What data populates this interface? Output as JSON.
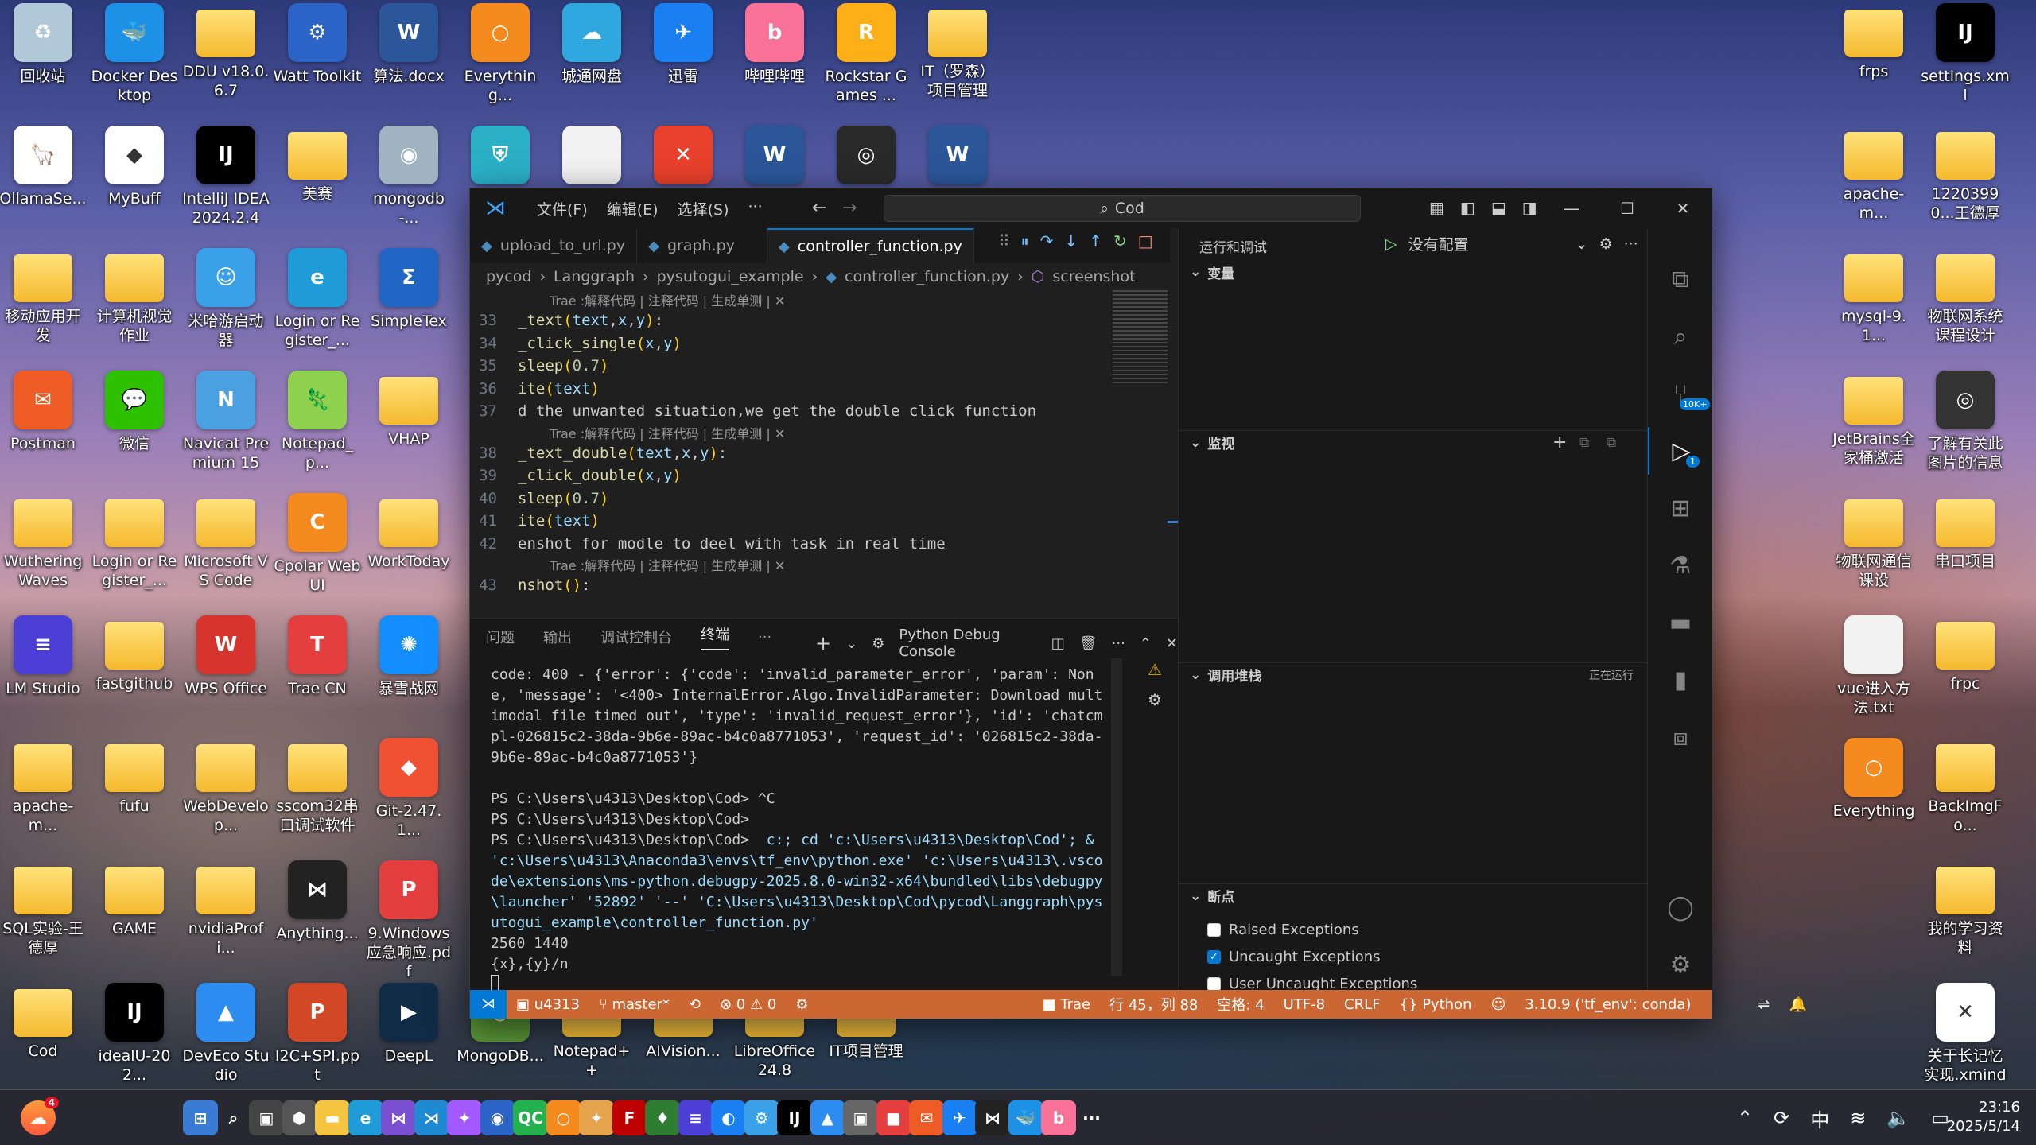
{
  "desktop_icons": [
    {
      "id": "recycle",
      "label": "回收站",
      "glyph": "♻",
      "color": "#b0c8d8"
    },
    {
      "id": "docker",
      "label": "Docker Desktop",
      "glyph": "🐳",
      "color": "#1d91e6"
    },
    {
      "id": "ddu",
      "label": "DDU v18.0.6.7",
      "glyph": "",
      "color": "folder"
    },
    {
      "id": "watt",
      "label": "Watt Toolkit",
      "glyph": "⚙",
      "color": "#2b63c6"
    },
    {
      "id": "docx1",
      "label": "算法.docx",
      "glyph": "W",
      "color": "#2b579a"
    },
    {
      "id": "everything1",
      "label": "Everything...",
      "glyph": "○",
      "color": "#f58a1f"
    },
    {
      "id": "cloud",
      "label": "城通网盘",
      "glyph": "☁",
      "color": "#2fa8e0"
    },
    {
      "id": "xunlei",
      "label": "迅雷",
      "glyph": "✈",
      "color": "#1a7ff0"
    },
    {
      "id": "bilibili",
      "label": "哔哩哔哩",
      "glyph": "b",
      "color": "#fb7299"
    },
    {
      "id": "rockstar",
      "label": "Rockstar Games ...",
      "glyph": "R",
      "color": "#fcaf17"
    },
    {
      "id": "itproj",
      "label": "IT（罗森）项目管理",
      "glyph": "",
      "color": "folder"
    },
    {
      "id": "ollama",
      "label": "OllamaSe...",
      "glyph": "🦙",
      "color": "#ffffff"
    },
    {
      "id": "mybuff",
      "label": "MyBuff",
      "glyph": "◆",
      "color": "#ffffff"
    },
    {
      "id": "idea",
      "label": "IntelliJ IDEA 2024.2.4",
      "glyph": "IJ",
      "color": "#000000"
    },
    {
      "id": "meisai",
      "label": "美赛",
      "glyph": "",
      "color": "folder"
    },
    {
      "id": "mongodb",
      "label": "mongodb-...",
      "glyph": "◉",
      "color": "#9fb4c0"
    },
    {
      "id": "shield",
      "label": "",
      "glyph": "⛨",
      "color": "#2bb0c8"
    },
    {
      "id": "blank",
      "label": "",
      "glyph": "",
      "color": "#f2f2f2"
    },
    {
      "id": "xmind",
      "label": "",
      "glyph": "✕",
      "color": "#e8412c"
    },
    {
      "id": "word2",
      "label": "",
      "glyph": "W",
      "color": "#2b579a"
    },
    {
      "id": "obs",
      "label": "",
      "glyph": "◎",
      "color": "#2a2a2a"
    },
    {
      "id": "word3",
      "label": "",
      "glyph": "W",
      "color": "#2b579a"
    },
    {
      "id": "mobileapp",
      "label": "移动应用开发",
      "glyph": "",
      "color": "folder"
    },
    {
      "id": "cvjob",
      "label": "计算机视觉作业",
      "glyph": "",
      "color": "folder"
    },
    {
      "id": "mihoyo",
      "label": "米哈游启动器",
      "glyph": "☺",
      "color": "#3aa0e8"
    },
    {
      "id": "edge",
      "label": "Login or Register_...",
      "glyph": "e",
      "color": "#1f9bd8"
    },
    {
      "id": "simpletex",
      "label": "SimpleTex",
      "glyph": "Σ",
      "color": "#2166c4"
    },
    {
      "id": "postman",
      "label": "Postman",
      "glyph": "✉",
      "color": "#ef5b25"
    },
    {
      "id": "wechat",
      "label": "微信",
      "glyph": "💬",
      "color": "#2dc100"
    },
    {
      "id": "navicat",
      "label": "Navicat Premium 15",
      "glyph": "N",
      "color": "#4aa0e0"
    },
    {
      "id": "notepadp",
      "label": "Notepad_p...",
      "glyph": "🦎",
      "color": "#8fd14f"
    },
    {
      "id": "vhap",
      "label": "VHAP",
      "glyph": "",
      "color": "folder"
    },
    {
      "id": "wuthering",
      "label": "Wuthering Waves",
      "glyph": "",
      "color": "folder"
    },
    {
      "id": "login2",
      "label": "Login or Register_...",
      "glyph": "",
      "color": "folder"
    },
    {
      "id": "msvscode",
      "label": "Microsoft VS Code",
      "glyph": "",
      "color": "folder"
    },
    {
      "id": "cpolar",
      "label": "Cpolar Web UI",
      "glyph": "C",
      "color": "#f58a1f"
    },
    {
      "id": "worktoday",
      "label": "WorkToday",
      "glyph": "",
      "color": "folder"
    },
    {
      "id": "lmstudio",
      "label": "LM Studio",
      "glyph": "≡",
      "color": "#4b3fd6"
    },
    {
      "id": "fastgithub",
      "label": "fastgithub",
      "glyph": "",
      "color": "folder"
    },
    {
      "id": "wps",
      "label": "WPS Office",
      "glyph": "W",
      "color": "#d6342c"
    },
    {
      "id": "tradecn",
      "label": "Trae CN",
      "glyph": "T",
      "color": "#e53e3e"
    },
    {
      "id": "game3",
      "label": "暴雪战网",
      "glyph": "✺",
      "color": "#148eff"
    },
    {
      "id": "apache1",
      "label": "apache-m...",
      "glyph": "",
      "color": "folder"
    },
    {
      "id": "fufu",
      "label": "fufu",
      "glyph": "",
      "color": "folder"
    },
    {
      "id": "webdev",
      "label": "WebDevelop...",
      "glyph": "",
      "color": "folder"
    },
    {
      "id": "sscom",
      "label": "sscom32串口调试软件",
      "glyph": "",
      "color": "folder"
    },
    {
      "id": "git",
      "label": "Git-2.47.1...",
      "glyph": "◆",
      "color": "#f05133"
    },
    {
      "id": "sqlexp",
      "label": "SQL实验-王德厚",
      "glyph": "",
      "color": "folder"
    },
    {
      "id": "game",
      "label": "GAME",
      "glyph": "",
      "color": "folder"
    },
    {
      "id": "nvidia",
      "label": "nvidiaProfi...",
      "glyph": "",
      "color": "folder"
    },
    {
      "id": "anything",
      "label": "Anything...",
      "glyph": "⋈",
      "color": "#222222"
    },
    {
      "id": "pdf",
      "label": "9.Windows应急响应.pdf",
      "glyph": "P",
      "color": "#e53e3e"
    },
    {
      "id": "cod",
      "label": "Cod",
      "glyph": "",
      "color": "folder"
    },
    {
      "id": "ideau",
      "label": "idealU-202...",
      "glyph": "IJ",
      "color": "#000000"
    },
    {
      "id": "deveco",
      "label": "DevEco Studio",
      "glyph": "▲",
      "color": "#2d8cf0"
    },
    {
      "id": "ppt",
      "label": "I2C+SPI.ppt",
      "glyph": "P",
      "color": "#d24726"
    },
    {
      "id": "deepl",
      "label": "DeepL",
      "glyph": "▶",
      "color": "#0f2b46"
    },
    {
      "id": "mongodb2",
      "label": "MongoDB...",
      "glyph": "◉",
      "color": "#589636"
    },
    {
      "id": "notepadpp",
      "label": "Notepad++",
      "glyph": "",
      "color": "folder"
    },
    {
      "id": "aivision",
      "label": "AIVision...",
      "glyph": "",
      "color": "folder"
    },
    {
      "id": "libre",
      "label": "LibreOffice 24.8",
      "glyph": "",
      "color": "folder"
    },
    {
      "id": "itmgmt",
      "label": "IT项目管理",
      "glyph": "",
      "color": "folder"
    },
    {
      "id": "frps",
      "label": "frps",
      "glyph": "",
      "color": "folder"
    },
    {
      "id": "settingsxml",
      "label": "settings.xml",
      "glyph": "IJ",
      "color": "#000000"
    },
    {
      "id": "apache2",
      "label": "apache-m...",
      "glyph": "",
      "color": "folder"
    },
    {
      "id": "wdh",
      "label": "12203990...王德厚",
      "glyph": "",
      "color": "folder"
    },
    {
      "id": "mysql",
      "label": "mysql-9.1...",
      "glyph": "",
      "color": "folder"
    },
    {
      "id": "iotcourse",
      "label": "物联网系统课程设计",
      "glyph": "",
      "color": "folder"
    },
    {
      "id": "jetbrains",
      "label": "JetBrains全家桶激活",
      "glyph": "",
      "color": "folder"
    },
    {
      "id": "learnmore",
      "label": "了解有关此图片的信息",
      "glyph": "◎",
      "color": "#333333"
    },
    {
      "id": "iotcomm",
      "label": "物联网通信课设",
      "glyph": "",
      "color": "folder"
    },
    {
      "id": "serial",
      "label": "串口项目",
      "glyph": "",
      "color": "folder"
    },
    {
      "id": "vuetxt",
      "label": "vue进入方法.txt",
      "glyph": "",
      "color": "#f2f2f2"
    },
    {
      "id": "frpc",
      "label": "frpc",
      "glyph": "",
      "color": "folder"
    },
    {
      "id": "everything2",
      "label": "Everything",
      "glyph": "○",
      "color": "#f58a1f"
    },
    {
      "id": "backimg",
      "label": "BackImgFo...",
      "glyph": "",
      "color": "folder"
    },
    {
      "id": "studyres",
      "label": "我的学习资料",
      "glyph": "",
      "color": "folder"
    },
    {
      "id": "memxmind",
      "label": "关于长记忆实现.xmind",
      "glyph": "✕",
      "color": "#ffffff"
    }
  ],
  "vscode": {
    "menu": [
      "文件(F)",
      "编辑(E)",
      "选择(S)",
      "···"
    ],
    "command_center": "Cod",
    "tabs": [
      "upload_to_url.py",
      "graph.py",
      "controller_function.py"
    ],
    "run_debug_title": "运行和调试",
    "run_config": "没有配置",
    "breadcrumb": [
      "pycod",
      "Langgraph",
      "pysutogui_example",
      "controller_function.py",
      "screenshot"
    ],
    "codelens": "Trae :解释代码 | 注释代码 | 生成单测 | ✕",
    "code_lines": [
      {
        "n": "",
        "lens": true
      },
      {
        "n": "33",
        "html": "<span class='tok-fn'>_text</span><span class='tok-p'>(</span><span class='tok-v'>text</span>,<span class='tok-v'>x</span>,<span class='tok-v'>y</span><span class='tok-p'>)</span>:"
      },
      {
        "n": "34",
        "html": "<span class='tok-fn'>_click_single</span><span class='tok-p'>(</span><span class='tok-v'>x</span>,<span class='tok-v'>y</span><span class='tok-p'>)</span>"
      },
      {
        "n": "35",
        "html": "<span class='tok-fn'>sleep</span><span class='tok-p'>(</span><span class='tok-n'>0.7</span><span class='tok-p'>)</span>"
      },
      {
        "n": "36",
        "html": "<span class='tok-fn'>ite</span><span class='tok-p'>(</span><span class='tok-v'>text</span><span class='tok-p'>)</span>"
      },
      {
        "n": "37",
        "html": "<span class='tok-c'>d the unwanted situation,we get the double click function</span>"
      },
      {
        "n": "",
        "lens": true
      },
      {
        "n": "38",
        "html": "<span class='tok-fn'>_text_double</span><span class='tok-p'>(</span><span class='tok-v'>text</span>,<span class='tok-v'>x</span>,<span class='tok-v'>y</span><span class='tok-p'>)</span>:"
      },
      {
        "n": "39",
        "html": "<span class='tok-fn'>_click_double</span><span class='tok-p'>(</span><span class='tok-v'>x</span>,<span class='tok-v'>y</span><span class='tok-p'>)</span>"
      },
      {
        "n": "40",
        "html": "<span class='tok-fn'>sleep</span><span class='tok-p'>(</span><span class='tok-n'>0.7</span><span class='tok-p'>)</span>"
      },
      {
        "n": "41",
        "html": "<span class='tok-fn'>ite</span><span class='tok-p'>(</span><span class='tok-v'>text</span><span class='tok-p'>)</span>"
      },
      {
        "n": "42",
        "html": "<span class='tok-c'>enshot for modle to deel with task in real time</span>"
      },
      {
        "n": "",
        "lens": true
      },
      {
        "n": "43",
        "html": "<span class='tok-fn'>nshot</span><span class='tok-p'>()</span>:"
      }
    ],
    "panel_tabs": [
      "问题",
      "输出",
      "调试控制台",
      "终端",
      "···"
    ],
    "panel_selector": "Python Debug Console",
    "terminal": [
      {
        "c": "",
        "t": "code: 400 - {'error': {'code': 'invalid_parameter_error', 'param': None, 'message': '<400> InternalError.Algo.InvalidParameter: Download multimodal file timed out', 'type': 'invalid_request_error'}, 'id': 'chatcmpl-026815c2-38da-9b6e-89ac-b4c0a8771053', 'request_id': '026815c2-38da-9b6e-89ac-b4c0a8771053'}"
      },
      {
        "c": "",
        "t": " "
      },
      {
        "c": "",
        "t": "PS C:\\Users\\u4313\\Desktop\\Cod> ^C"
      },
      {
        "c": "",
        "t": "PS C:\\Users\\u4313\\Desktop\\Cod>"
      },
      {
        "c": "cmd",
        "t": "PS C:\\Users\\u4313\\Desktop\\Cod>  c:; cd 'c:\\Users\\u4313\\Desktop\\Cod'; & 'c:\\Users\\u4313\\Anaconda3\\envs\\tf_env\\python.exe' 'c:\\Users\\u4313\\.vscode\\extensions\\ms-python.debugpy-2025.8.0-win32-x64\\bundled\\libs\\debugpy\\launcher' '52892' '--' 'C:\\Users\\u4313\\Desktop\\Cod\\pycod\\Langgraph\\pysutogui_example\\controller_function.py'"
      },
      {
        "c": "",
        "t": "2560 1440"
      },
      {
        "c": "",
        "t": "{x},{y}/n"
      }
    ],
    "sections": {
      "variables": "变量",
      "watch": "监视",
      "callstack": "调用堆栈",
      "callstack_status": "正在运行",
      "breakpoints": "断点"
    },
    "breakpoints": [
      {
        "label": "Raised Exceptions",
        "checked": false
      },
      {
        "label": "Uncaught Exceptions",
        "checked": true
      },
      {
        "label": "User Uncaught Exceptions",
        "checked": false
      }
    ],
    "activity_badges": {
      "scm": "10K+",
      "debug": "1"
    },
    "status": {
      "remote": "⋊",
      "user": "u4313",
      "branch": "master*",
      "errors": "⊗ 0 ⚠ 0",
      "trae": "Trae",
      "position": "行 45，列 88",
      "spaces": "空格: 4",
      "encoding": "UTF-8",
      "eol": "CRLF",
      "lang": "{} Python",
      "interpreter": "3.10.9 ('tf_env': conda)"
    }
  },
  "taskbar": {
    "weather_badge": "4",
    "clock_time": "23:16",
    "clock_date": "2025/5/14",
    "ime": "中"
  }
}
